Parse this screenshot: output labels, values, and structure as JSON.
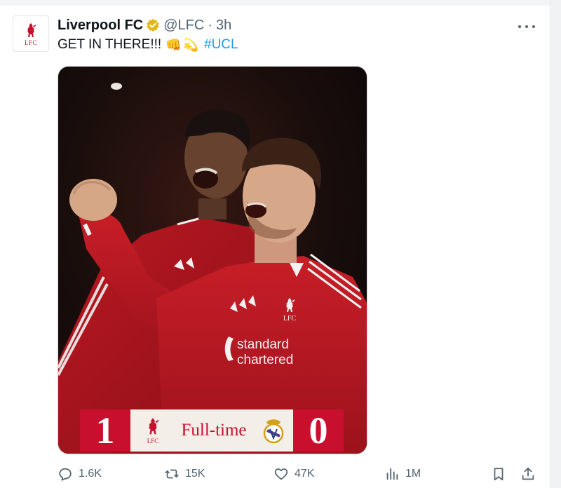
{
  "tweet": {
    "author_name": "Liverpool FC",
    "handle": "@LFC",
    "separator": "·",
    "time": "3h",
    "text": "GET IN THERE!!!",
    "emojis": [
      "👊",
      "💫"
    ],
    "hashtag": "#UCL",
    "avatar_text": "LFC",
    "verified_color": "#e2b719"
  },
  "media": {
    "image_subject": "two-players-celebrating",
    "sponsor_text": [
      "standard",
      "chartered"
    ],
    "shirt_crest_text": "LFC",
    "scoreboard": {
      "home_score": "1",
      "away_score": "0",
      "home_crest_text": "LFC",
      "label": "Full-time",
      "colors": {
        "accent": "#c8102e",
        "panel": "#f3efe8"
      }
    }
  },
  "actions": {
    "reply_count": "1.6K",
    "retweet_count": "15K",
    "like_count": "47K",
    "views_count": "1M"
  },
  "colors": {
    "text": "#0f1419",
    "muted": "#536471",
    "link": "#1d9bf0",
    "brand_red": "#c8102e"
  }
}
